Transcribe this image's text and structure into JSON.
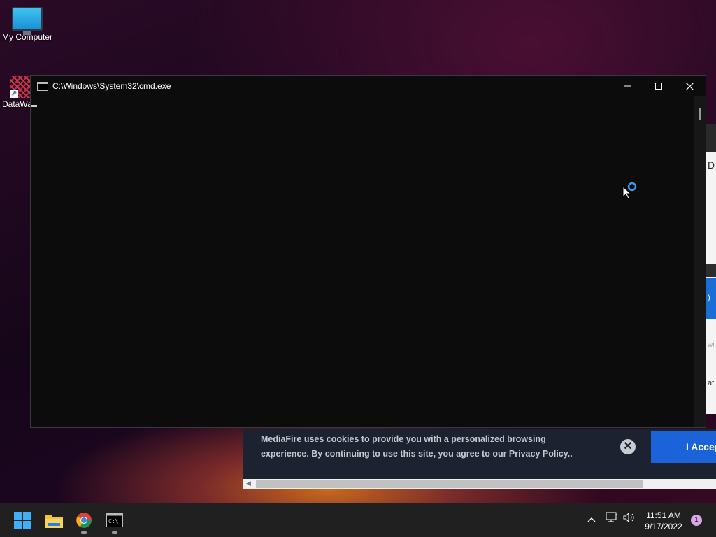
{
  "desktop": {
    "icons": [
      {
        "label": "My Computer",
        "icon": "monitor-icon"
      },
      {
        "label": "DataWa",
        "icon": "shortcut-icon"
      }
    ]
  },
  "cmd": {
    "title": "C:\\Windows\\System32\\cmd.exe",
    "buttons": {
      "minimize": "minimize-icon",
      "maximize": "maximize-icon",
      "close": "close-icon"
    }
  },
  "background_browser": {
    "partial_texts": [
      "D",
      ")",
      "wi",
      "at"
    ]
  },
  "cookie_banner": {
    "text": "MediaFire uses cookies to provide you with a personalized browsing experience. By continuing to use this site, you agree to our Privacy Policy..",
    "accept_label": "I Accep",
    "close_symbol": "✕"
  },
  "taskbar": {
    "apps": [
      "start-icon",
      "file-explorer-icon",
      "chrome-icon",
      "cmd-icon"
    ],
    "clock_time": "11:51 AM",
    "clock_date": "9/17/2022",
    "notification_count": "1"
  },
  "colors": {
    "accept_button": "#1a63d8",
    "cookie_banner_bg": "#1d2230",
    "taskbar_bg": "#202020",
    "cmd_bg": "#0c0c0c"
  }
}
